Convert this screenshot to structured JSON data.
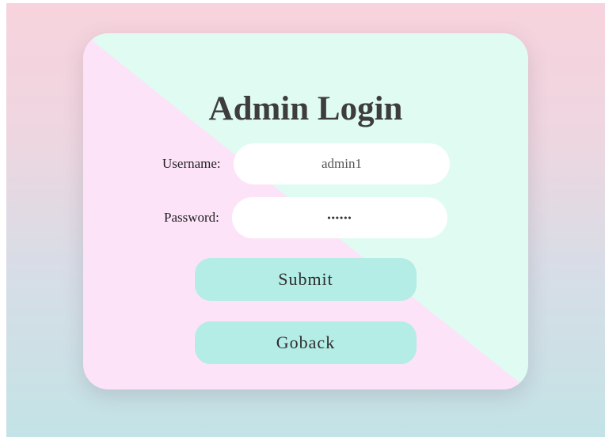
{
  "login": {
    "title": "Admin Login",
    "username": {
      "label": "Username:",
      "value": "admin1"
    },
    "password": {
      "label": "Password:",
      "value": "••••••"
    },
    "submit_label": "Submit",
    "goback_label": "Goback"
  },
  "colors": {
    "card_mint": "#dffbf2",
    "card_pink": "#fde3f8",
    "button_bg": "#b4ece6",
    "field_bg": "#ffffff",
    "title_color": "#3d3d3d"
  }
}
